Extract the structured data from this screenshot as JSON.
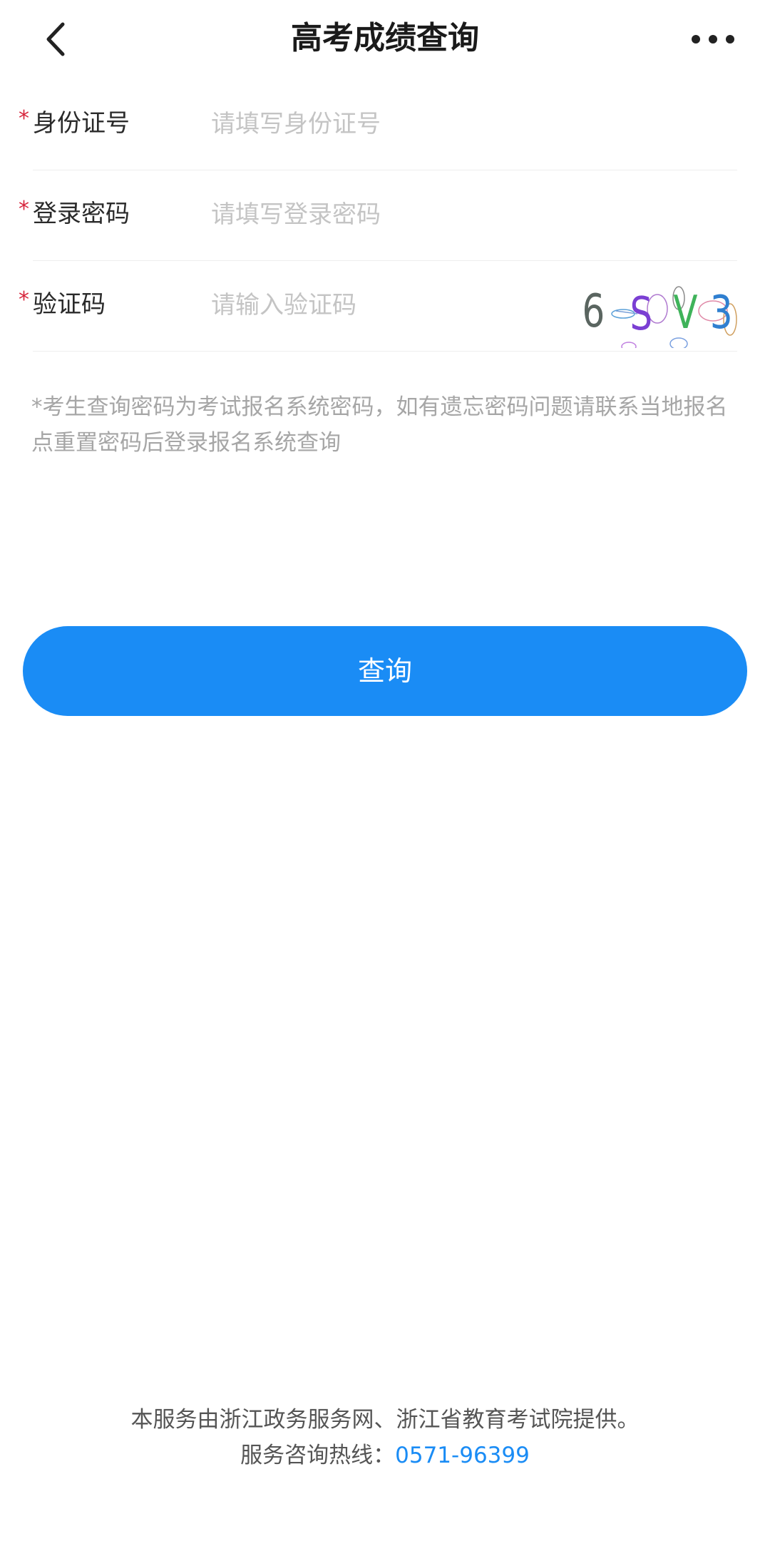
{
  "nav": {
    "title": "高考成绩查询"
  },
  "form": {
    "id_number": {
      "label": "身份证号",
      "placeholder": "请填写身份证号",
      "value": ""
    },
    "password": {
      "label": "登录密码",
      "placeholder": "请填写登录密码",
      "value": ""
    },
    "captcha": {
      "label": "验证码",
      "placeholder": "请输入验证码",
      "value": "",
      "image_text": "6SV3"
    }
  },
  "hint": "*考生查询密码为考试报名系统密码，如有遗忘密码问题请联系当地报名点重置密码后登录报名系统查询",
  "buttons": {
    "query_label": "查询"
  },
  "footer": {
    "line1": "本服务由浙江政务服务网、浙江省教育考试院提供。",
    "hotline_label": "服务咨询热线：",
    "hotline_number": "0571-96399"
  },
  "colors": {
    "primary": "#1a8cf5",
    "required": "#d7263d",
    "placeholder": "#c4c4c4",
    "hint": "#a6a6a6"
  }
}
